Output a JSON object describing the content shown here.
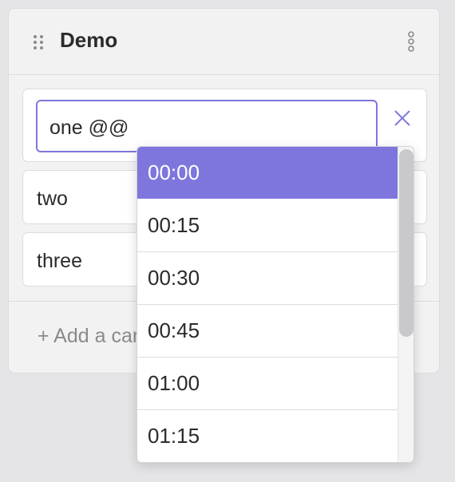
{
  "lane": {
    "title": "Demo",
    "add_card_label": "+ Add a card",
    "cards": [
      {
        "text": "one @@",
        "editing": true
      },
      {
        "text": "two"
      },
      {
        "text": "three"
      }
    ]
  },
  "time_dropdown": {
    "selected": "00:00",
    "options": [
      "00:00",
      "00:15",
      "00:30",
      "00:45",
      "01:00",
      "01:15"
    ],
    "scroll_position": 0
  },
  "colors": {
    "accent": "#7e76dd",
    "background": "#e5e5e7",
    "lane": "#f2f2f3"
  }
}
